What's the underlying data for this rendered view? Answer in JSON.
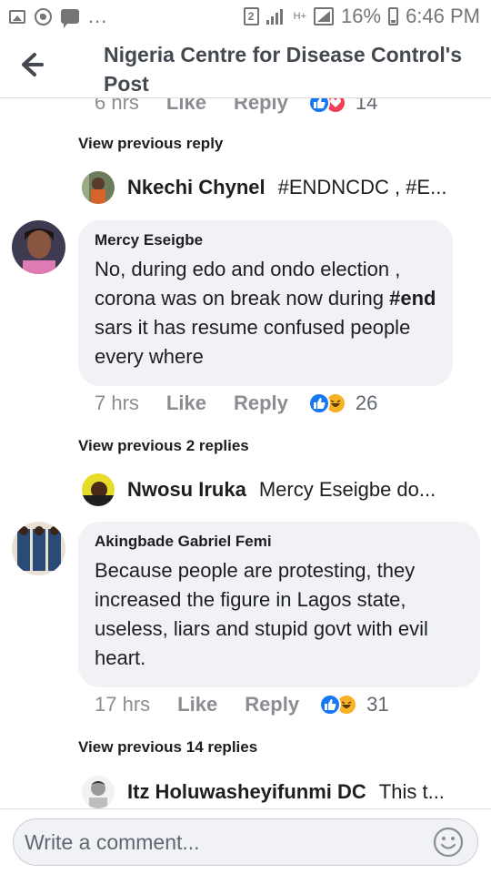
{
  "status_bar": {
    "icons": [
      "gallery-icon",
      "whatsapp-icon",
      "message-icon",
      "more-dots-icon",
      "sim-icon",
      "signal-icon",
      "ht-icon",
      "signal-icon",
      "battery-icon"
    ],
    "more": "...",
    "sim_label": "2",
    "network": "H+",
    "battery_pct": "16%",
    "time": "6:46 PM"
  },
  "header": {
    "back_icon": "arrow-left-icon",
    "title": "Nigeria Centre for Disease Control's Post"
  },
  "partial_top": {
    "time": "6 hrs",
    "like": "Like",
    "reply": "Reply",
    "reactions": [
      "like",
      "love"
    ],
    "count": "14"
  },
  "threads": [
    {
      "view_previous": "View previous reply",
      "reply": {
        "name": "Nkechi Chynel",
        "text": "#ENDNCDC , #E..."
      }
    },
    {
      "comment": {
        "name": "Mercy Eseigbe",
        "text_pre": "No,  during edo and ondo election , corona was on break now during ",
        "hashtag": "#end",
        "text_post": " sars it has resume confused people every where",
        "time": "7 hrs",
        "like": "Like",
        "reply": "Reply",
        "reactions": [
          "like",
          "haha"
        ],
        "count": "26"
      },
      "view_previous": "View previous 2 replies",
      "reply": {
        "name": "Nwosu Iruka",
        "text": "Mercy Eseigbe do..."
      }
    },
    {
      "comment": {
        "name": "Akingbade Gabriel Femi",
        "text": "Because people are protesting, they increased the figure in Lagos state, useless, liars and stupid govt with evil heart.",
        "time": "17 hrs",
        "like": "Like",
        "reply": "Reply",
        "reactions": [
          "like",
          "haha"
        ],
        "count": "31"
      },
      "view_previous": "View previous 14 replies",
      "reply": {
        "name": "Itz Holuwasheyifunmi DC",
        "text": "This t..."
      }
    }
  ],
  "composer": {
    "placeholder": "Write a comment...",
    "emoji_icon": "emoji-smile-icon"
  },
  "colors": {
    "like_blue": "#1877f2",
    "haha_yellow": "#f7b125",
    "love_red": "#f33e58",
    "bubble_bg": "#f0f2f5",
    "meta_grey": "#8a8d91"
  }
}
